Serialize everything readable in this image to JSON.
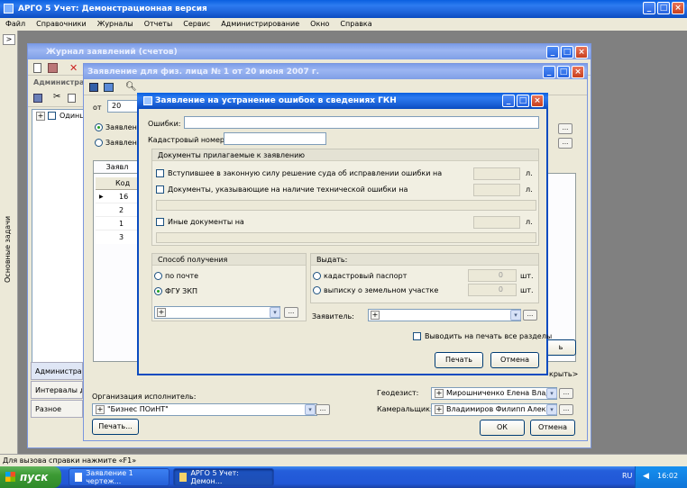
{
  "app": {
    "title": "АРГО 5 Учет: Демонстрационная версия",
    "menu": [
      "Файл",
      "Справочники",
      "Журналы",
      "Отчеты",
      "Сервис",
      "Администрирование",
      "Окно",
      "Справка"
    ]
  },
  "sidebar": {
    "toggle": ">",
    "label": "Основные задачи"
  },
  "journal": {
    "title": "Журнал заявлений (счетов)",
    "admin_label": "Администрат",
    "tree_item": "Одинцо"
  },
  "application": {
    "title": "Заявление для физ. лица № 1 от 20 июня 2007 г.",
    "from_label": "от",
    "from_value": "20",
    "radio1": "Заявлен",
    "radio2": "Заявлен",
    "tab": "Заявл",
    "col_code": "Код",
    "rows": [
      "16",
      "2",
      "1",
      "3"
    ],
    "side_tabs": [
      "Администра",
      "Интервалы да",
      "Разное"
    ],
    "org_label": "Организация исполнитель:",
    "org_value": "\"Бизнес ПОиНТ\"",
    "geodesist_label": "Геодезист:",
    "geodesist_value": "Мирошниченко Елена Владими",
    "cameral_label": "Камеральщик:",
    "cameral_value": "Владимиров Филипп Алексан",
    "print_btn": "Печать...",
    "ok_btn": "ОК",
    "cancel_btn": "Отмена",
    "behind_btn_partial": "ь",
    "behind_link": "крыть>"
  },
  "dialog": {
    "title": "Заявление на устранение ошибок в сведениях ГКН",
    "errors_label": "Ошибки:",
    "cadastral_label": "Кадастровый номер:",
    "docs_group": "Документы прилагаемые к заявлению",
    "doc1": "Вступившее в законную силу решение суда об исправлении ошибки на",
    "doc2": "Документы, указывающие на наличие технической ошибки на",
    "doc3": "Иные документы на",
    "pages_unit": "л.",
    "method_group": "Способ получения",
    "by_mail": "по почте",
    "fgu": "ФГУ ЗКП",
    "issue_group": "Выдать:",
    "passport": "кадастровый паспорт",
    "extract": "выписку о земельном участке",
    "pcs_unit": "шт.",
    "passport_count": "0",
    "extract_count": "0",
    "applicant_label": "Заявитель:",
    "print_all": "Выводить на печать все разделы",
    "print_btn": "Печать",
    "cancel_btn": "Отмена"
  },
  "status": {
    "hint": "Для вызова справки нажмите «F1»"
  },
  "taskbar": {
    "start": "пуск",
    "tasks": [
      "Заявление 1 чертеж...",
      "АРГО 5 Учет: Демон..."
    ],
    "lang": "RU",
    "time": "16:02"
  }
}
